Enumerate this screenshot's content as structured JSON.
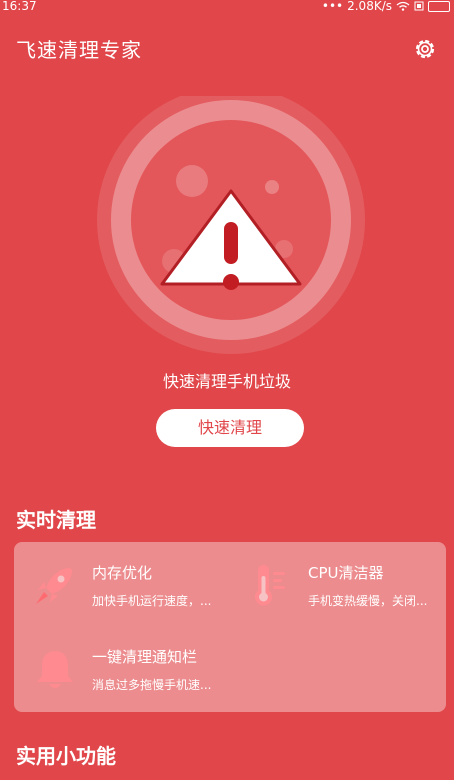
{
  "status": {
    "time": "16:37",
    "speed": "2.08K/s",
    "signal_dots": "•••"
  },
  "header": {
    "title": "飞速清理专家",
    "settings_icon": "gear-icon"
  },
  "hero": {
    "icon": "warning-triangle-icon",
    "caption": "快速清理手机垃圾",
    "button_label": "快速清理"
  },
  "realtime": {
    "title": "实时清理",
    "items": [
      {
        "title": "内存优化",
        "desc": "加快手机运行速度，...",
        "icon": "rocket-icon"
      },
      {
        "title": "CPU清洁器",
        "desc": "手机变热缓慢，关闭...",
        "icon": "thermometer-icon"
      },
      {
        "title": "一键清理通知栏",
        "desc": "消息过多拖慢手机速...",
        "icon": "bell-icon"
      }
    ]
  },
  "tools": {
    "title": "实用小功能"
  },
  "colors": {
    "background": "#e0464a",
    "accent": "#ff8a8f",
    "button_text": "#e0464a"
  }
}
